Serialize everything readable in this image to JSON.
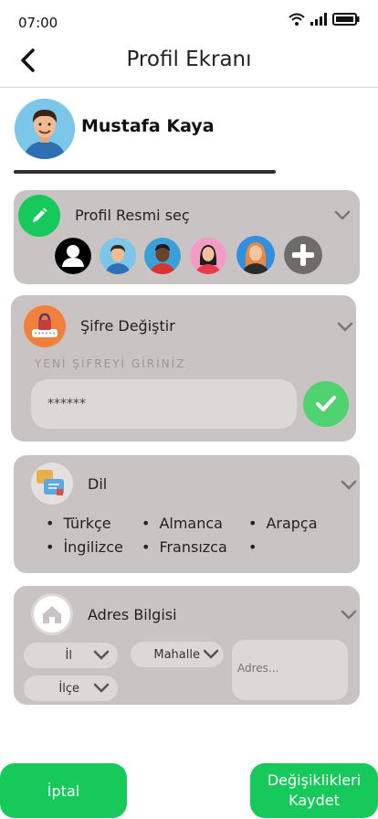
{
  "status_bar": {
    "time": "07:00"
  },
  "header": {
    "title": "Profil Ekranı"
  },
  "user": {
    "name": "Mustafa Kaya"
  },
  "profile_picture": {
    "title": "Profil Resmi seç",
    "options": [
      "default-avatar",
      "man-avatar",
      "dark-man-avatar",
      "woman-avatar",
      "blonde-woman-avatar",
      "add"
    ]
  },
  "password": {
    "title": "Şifre Değiştir",
    "hint": "YENİ ŞİFREYİ GİRİNİZ",
    "value": "******"
  },
  "language": {
    "title": "Dil",
    "options": [
      "Türkçe",
      "Almanca",
      "Arapça",
      "İngilizce",
      "Fransızca",
      ""
    ]
  },
  "address": {
    "title": "Adres Bilgisi",
    "province_label": "İl",
    "district_label": "İlçe",
    "neighborhood_label": "Mahalle",
    "address_placeholder": "Adres..."
  },
  "actions": {
    "cancel_label": "İptal",
    "save_label": "Değişiklikleri Kaydet"
  },
  "colors": {
    "accent_green": "#16c95a",
    "card_bg": "#c9c4c3",
    "confirm_green": "#4fd26f",
    "lock_orange": "#f0803c"
  }
}
